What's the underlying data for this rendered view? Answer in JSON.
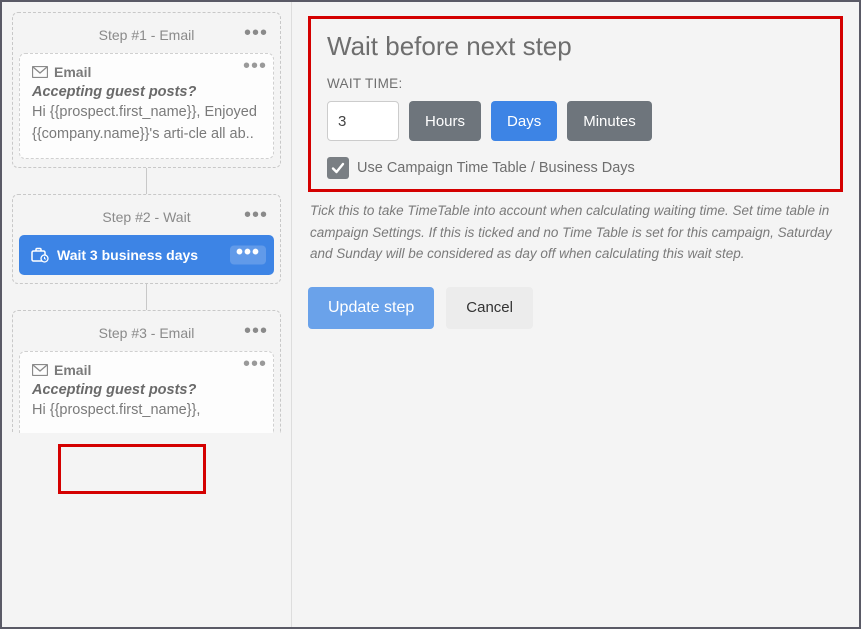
{
  "sidebar": {
    "steps": [
      {
        "header": "Step #1 - Email",
        "inner_title": "Email",
        "subject": "Accepting guest posts?",
        "body": "Hi {{prospect.first_name}}, Enjoyed {{company.name}}'s arti-cle all ab.."
      },
      {
        "header": "Step #2 - Wait",
        "wait_label": "Wait 3 business days"
      },
      {
        "header": "Step #3 - Email",
        "inner_title": "Email",
        "subject": "Accepting guest posts?",
        "body": "Hi {{prospect.first_name}},"
      }
    ]
  },
  "panel": {
    "title": "Wait before next step",
    "wait_label": "WAIT TIME:",
    "value": "3",
    "units": {
      "hours": "Hours",
      "days": "Days",
      "minutes": "Minutes"
    },
    "checkbox_label": "Use Campaign Time Table / Business Days",
    "hint": "Tick this to take TimeTable into account when calculating waiting time. Set time table in campaign Settings. If this is ticked and no Time Table is set for this campaign, Saturday and Sunday will be considered as day off when calculating this wait step.",
    "update": "Update step",
    "cancel": "Cancel"
  }
}
